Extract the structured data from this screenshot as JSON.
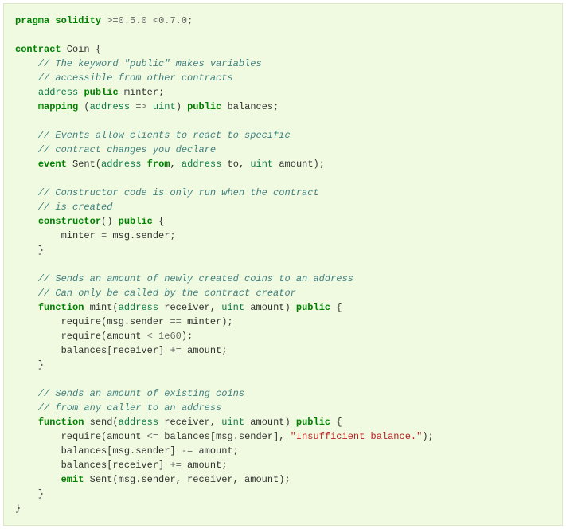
{
  "code": {
    "l1": {
      "kw1": "pragma",
      "kw2": "solidity",
      "op1": ">=",
      "n1": "0.5",
      "p1": ".",
      "n2": "0",
      "op2": "<",
      "n3": "0.7",
      "p2": ".",
      "n4": "0",
      "p3": ";"
    },
    "l3": {
      "kw1": "contract",
      "id1": " Coin {"
    },
    "l4": {
      "cmt": "    // The keyword \"public\" makes variables"
    },
    "l5": {
      "cmt": "    // accessible from other contracts"
    },
    "l6": {
      "pre": "    ",
      "t1": "address",
      "sp1": " ",
      "kw1": "public",
      "id1": " minter;"
    },
    "l7": {
      "pre": "    ",
      "kw1": "mapping",
      "sp1": " (",
      "t1": "address",
      "op1": " => ",
      "t2": "uint",
      "sp2": ") ",
      "kw2": "public",
      "id1": " balances;"
    },
    "l9": {
      "cmt": "    // Events allow clients to react to specific"
    },
    "l10": {
      "cmt": "    // contract changes you declare"
    },
    "l11": {
      "pre": "    ",
      "kw1": "event",
      "id1": " Sent(",
      "t1": "address",
      "sp1": " ",
      "kw2": "from",
      "p1": ", ",
      "t2": "address",
      "id2": " to, ",
      "t3": "uint",
      "id3": " amount);"
    },
    "l13": {
      "cmt": "    // Constructor code is only run when the contract"
    },
    "l14": {
      "cmt": "    // is created"
    },
    "l15": {
      "pre": "    ",
      "kw1": "constructor",
      "id1": "() ",
      "kw2": "public",
      "id2": " {"
    },
    "l16": {
      "id1": "        minter ",
      "op1": "=",
      "id2": " msg.sender;"
    },
    "l17": {
      "id1": "    }"
    },
    "l19": {
      "cmt": "    // Sends an amount of newly created coins to an address"
    },
    "l20": {
      "cmt": "    // Can only be called by the contract creator"
    },
    "l21": {
      "pre": "    ",
      "kw1": "function",
      "id1": " mint(",
      "t1": "address",
      "id2": " receiver, ",
      "t2": "uint",
      "id3": " amount) ",
      "kw2": "public",
      "id4": " {"
    },
    "l22": {
      "id1": "        require(msg.sender ",
      "op1": "==",
      "id2": " minter);"
    },
    "l23": {
      "id1": "        require(amount ",
      "op1": "<",
      "sp1": " ",
      "n1": "1e60",
      "id2": ");"
    },
    "l24": {
      "id1": "        balances[receiver] ",
      "op1": "+=",
      "id2": " amount;"
    },
    "l25": {
      "id1": "    }"
    },
    "l27": {
      "cmt": "    // Sends an amount of existing coins"
    },
    "l28": {
      "cmt": "    // from any caller to an address"
    },
    "l29": {
      "pre": "    ",
      "kw1": "function",
      "id1": " send(",
      "t1": "address",
      "id2": " receiver, ",
      "t2": "uint",
      "id3": " amount) ",
      "kw2": "public",
      "id4": " {"
    },
    "l30": {
      "id1": "        require(amount ",
      "op1": "<=",
      "id2": " balances[msg.sender], ",
      "str1": "\"Insufficient balance.\"",
      "id3": ");"
    },
    "l31": {
      "id1": "        balances[msg.sender] ",
      "op1": "-=",
      "id2": " amount;"
    },
    "l32": {
      "id1": "        balances[receiver] ",
      "op1": "+=",
      "id2": " amount;"
    },
    "l33": {
      "pre": "        ",
      "kw1": "emit",
      "id1": " Sent(msg.sender, receiver, amount);"
    },
    "l34": {
      "id1": "    }"
    },
    "l35": {
      "id1": "}"
    }
  }
}
